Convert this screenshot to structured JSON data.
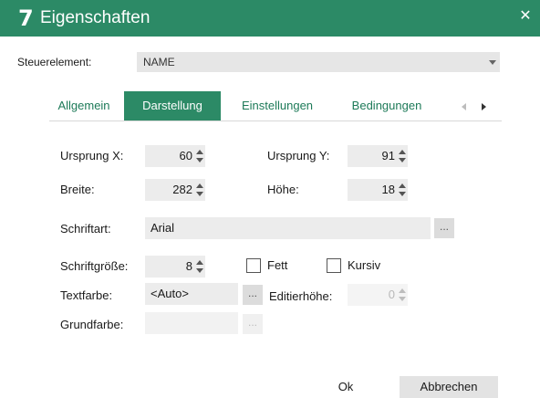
{
  "window": {
    "logo": "7",
    "title": "Eigenschaften",
    "close_icon": "close-icon"
  },
  "steuerelement": {
    "label": "Steuerelement:",
    "value": "NAME"
  },
  "tabs": [
    {
      "label": "Allgemein",
      "active": false
    },
    {
      "label": "Darstellung",
      "active": true
    },
    {
      "label": "Einstellungen",
      "active": false
    },
    {
      "label": "Bedingungen",
      "active": false
    }
  ],
  "position": {
    "ursprung_x_label": "Ursprung X:",
    "ursprung_x": "60",
    "ursprung_y_label": "Ursprung Y:",
    "ursprung_y": "91",
    "breite_label": "Breite:",
    "breite": "282",
    "hoehe_label": "Höhe:",
    "hoehe": "18"
  },
  "font": {
    "schriftart_label": "Schriftart:",
    "schriftart": "Arial",
    "browse": "...",
    "groesse_label": "Schriftgröße:",
    "groesse": "8",
    "fett_label": "Fett",
    "fett_checked": false,
    "kursiv_label": "Kursiv",
    "kursiv_checked": false
  },
  "colors": {
    "textfarbe_label": "Textfarbe:",
    "textfarbe": "<Auto>",
    "textfarbe_browse": "...",
    "editierhoehe_label": "Editierhöhe:",
    "editierhoehe": "0",
    "grundfarbe_label": "Grundfarbe:",
    "grundfarbe": "",
    "grundfarbe_browse": "..."
  },
  "buttons": {
    "ok": "Ok",
    "cancel": "Abbrechen"
  },
  "theme": {
    "accent": "#2c8a66"
  }
}
